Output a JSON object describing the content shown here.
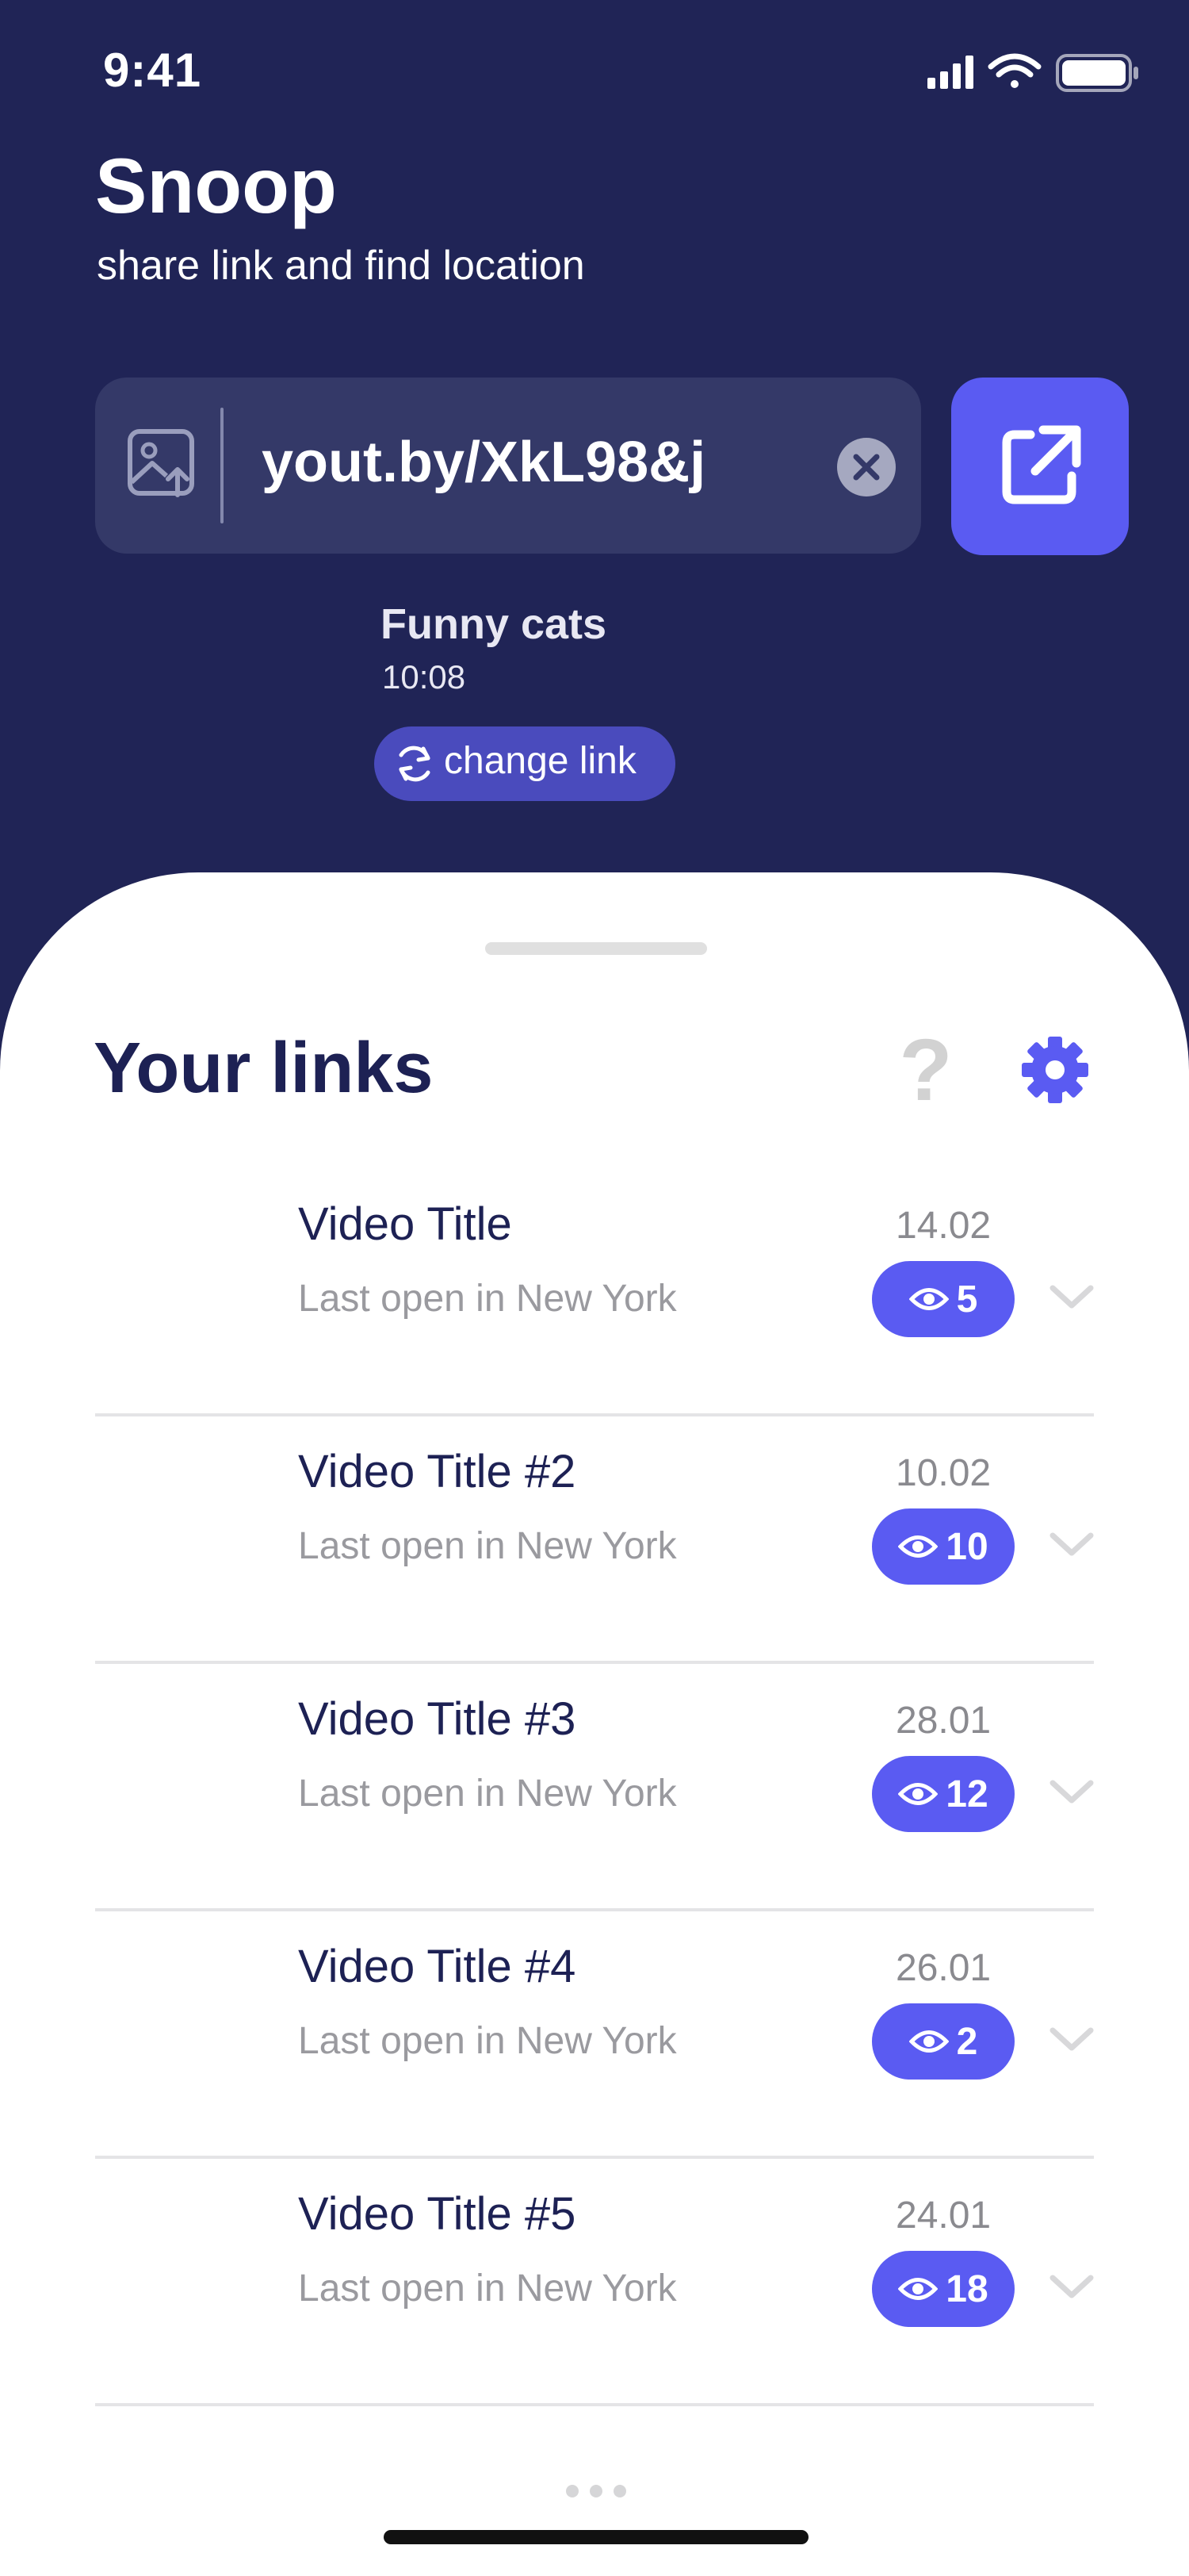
{
  "status_bar": {
    "time": "9:41",
    "icons": [
      "signal-icon",
      "wifi-icon",
      "battery-icon"
    ]
  },
  "header": {
    "title": "Snoop",
    "subtitle": "share link and find location"
  },
  "link_input": {
    "value": "yout.by/XkL98&j",
    "leading_icon": "image-upload-icon",
    "clear_icon": "clear-icon",
    "action_icon": "share-external-icon"
  },
  "current_link": {
    "title": "Funny cats",
    "time": "10:08",
    "change_label": "change link"
  },
  "links_section": {
    "title": "Your links",
    "help_icon": "?",
    "items": [
      {
        "title": "Video Title",
        "subtitle": "Last open in New York",
        "date": "14.02",
        "views": "5"
      },
      {
        "title": "Video Title #2",
        "subtitle": "Last open in New York",
        "date": "10.02",
        "views": "10"
      },
      {
        "title": "Video Title #3",
        "subtitle": "Last open in New York",
        "date": "28.01",
        "views": "12"
      },
      {
        "title": "Video Title #4",
        "subtitle": "Last open in New York",
        "date": "26.01",
        "views": "2"
      },
      {
        "title": "Video Title #5",
        "subtitle": "Last open in New York",
        "date": "24.01",
        "views": "18"
      }
    ]
  },
  "colors": {
    "background": "#202456",
    "accent": "#5a5bf2",
    "field": "#343968",
    "title_text": "#1d2154"
  }
}
